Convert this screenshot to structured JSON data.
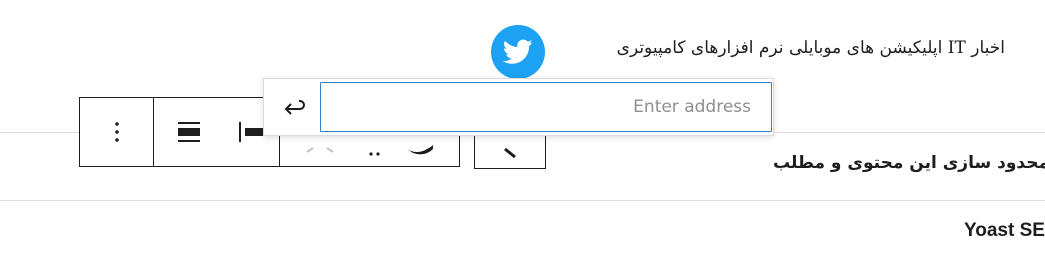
{
  "content": {
    "text_line": "اخبار IT  اپلیکیشن های موبایلی  نرم افزارهای کامپیوتری",
    "social_icon": "twitter-icon",
    "social_color": "#1da1f2"
  },
  "link_popover": {
    "placeholder": "Enter address",
    "value": "",
    "submit_icon": "return-arrow-icon"
  },
  "toolbar": {
    "icons": [
      "options-vertical-dots-icon",
      "align-center-icon",
      "align-left-icon",
      "twitter-icon",
      "link-icon"
    ]
  },
  "panel": {
    "limit_title": "محدود سازی این محتوی و مطلب",
    "yoast_title": "Yoast SEO"
  }
}
